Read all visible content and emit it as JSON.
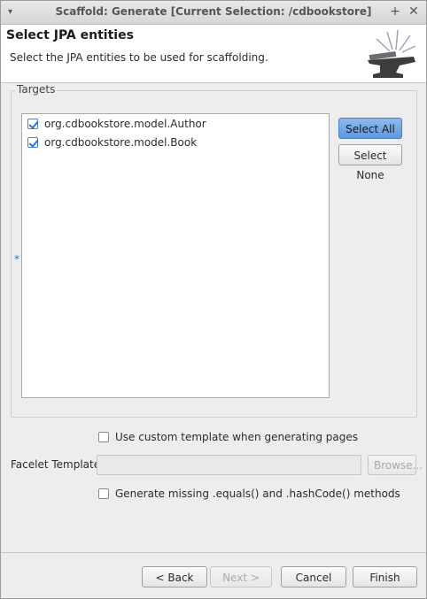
{
  "window": {
    "title": "Scaffold: Generate [Current Selection: /cdbookstore]"
  },
  "header": {
    "title": "Select JPA entities",
    "description": "Select the JPA entities to be used for scaffolding."
  },
  "targets": {
    "label": "Targets",
    "required_marker": "*",
    "items": [
      {
        "label": "org.cdbookstore.model.Author",
        "checked": true
      },
      {
        "label": "org.cdbookstore.model.Book",
        "checked": true
      }
    ],
    "select_all_label": "Select All",
    "select_none_label": "Select None"
  },
  "options": {
    "custom_template_label": "Use custom template when generating pages",
    "custom_template_checked": false,
    "facelet_template_label": "Facelet Template:",
    "facelet_template_value": "",
    "browse_label": "Browse...",
    "generate_equals_label": "Generate missing .equals() and .hashCode() methods",
    "generate_equals_checked": false
  },
  "footer": {
    "back_label": "< Back",
    "next_label": "Next >",
    "cancel_label": "Cancel",
    "finish_label": "Finish"
  },
  "icons": {
    "title_arrow": "dropdown-arrow-icon",
    "maximize": "plus-icon",
    "close": "close-icon",
    "wizard_banner": "anvil-icon"
  },
  "colors": {
    "accent": "#5f97de",
    "check": "#2f6fd1"
  }
}
